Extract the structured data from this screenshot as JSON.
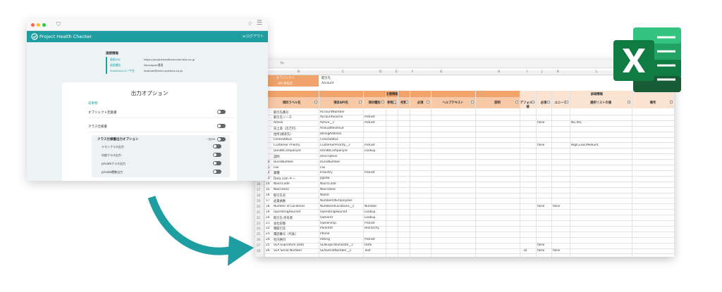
{
  "browser": {
    "app_title": "Project Health Checker",
    "logout_label": "ログアウト",
    "info": {
      "title": "接続情報",
      "rows": [
        {
          "k": "接続URL",
          "v": "https://projecthealthchecker.test.co.jp"
        },
        {
          "k": "接続種別",
          "v": "Developer環境"
        },
        {
          "k": "Salesforceユーザ名",
          "v": "testmail@ohm-systems.co.jp"
        }
      ]
    },
    "card": {
      "title": "出力オプション",
      "section": "成果物",
      "options": [
        "オブジェクト定義書",
        "クラス仕様書"
      ],
      "subsection": {
        "title": "クラス仕様書出力オプション",
        "all_label": "一括ON",
        "items": [
          "テストクラス出力",
          "内部クラス出力",
          "privateクラス出力",
          "private関数出力"
        ]
      }
    }
  },
  "excel": {
    "formula_bar": {
      "cell_ref": "A1",
      "fx": "fx"
    },
    "col_letters": [
      "B",
      "C",
      "D",
      "E",
      "F",
      "G",
      "H",
      "I",
      "J",
      "K",
      "L"
    ],
    "meta": [
      {
        "label": "オブジェクト",
        "value": "取引先"
      },
      {
        "label": "API 参照名",
        "value": "Account"
      }
    ],
    "group_headers": {
      "main": "主要情報",
      "detail": "詳細情報"
    },
    "headers": [
      "項目ラベル名",
      "項目API名",
      "項目種別",
      "参照先",
      "桁数",
      "必須",
      "ヘルプテキスト",
      "説明",
      "デフォルト値",
      "必須",
      "ユニーク",
      "選択リストの値",
      "備考"
    ],
    "rows": [
      {
        "n": "1",
        "label": "取引先番号",
        "api": "AccountNumber",
        "type": ""
      },
      {
        "n": "2",
        "label": "取引先ソース",
        "api": "AccountSource",
        "type": "Picklist"
      },
      {
        "n": "3",
        "label": "Active",
        "api": "Active__c",
        "type": "Picklist",
        "req": "false",
        "pick": "No,Yes;"
      },
      {
        "n": "4",
        "label": "売上高（百万円）",
        "api": "AnnualRevenue",
        "type": ""
      },
      {
        "n": "5",
        "label": "住所(請求先)",
        "api": "BillingAddress",
        "type": ""
      },
      {
        "n": "6",
        "label": "CleanStatus",
        "api": "CleanStatus",
        "type": ""
      },
      {
        "n": "7",
        "label": "Customer Priority",
        "api": "CustomerPriority__c",
        "type": "Picklist",
        "req": "false",
        "pick": "High,Low,Medium;"
      },
      {
        "n": "8",
        "label": "DandbCompanyId",
        "api": "DandbCompanyId",
        "type": "Lookup"
      },
      {
        "n": "9",
        "label": "説明",
        "api": "Description",
        "type": ""
      },
      {
        "n": "10",
        "label": "DunsNumber",
        "api": "DunsNumber",
        "type": ""
      },
      {
        "n": "11",
        "label": "Fax",
        "api": "Fax",
        "type": ""
      },
      {
        "n": "12",
        "label": "業種",
        "api": "Industry",
        "type": "Picklist"
      },
      {
        "n": "13",
        "label": "Data.com キー",
        "api": "Jigsaw",
        "type": ""
      },
      {
        "n": "14",
        "label": "NaicsCode",
        "api": "NaicsCode",
        "type": ""
      },
      {
        "n": "15",
        "label": "NaicsDesc",
        "api": "NaicsDesc",
        "type": ""
      },
      {
        "n": "16",
        "label": "取引先名",
        "api": "Name",
        "type": ""
      },
      {
        "n": "17",
        "label": "従業員数",
        "api": "NumberOfEmployees",
        "type": ""
      },
      {
        "n": "18",
        "label": "Number of Locations",
        "api": "NumberofLocations__c",
        "type": "Number",
        "req": "false",
        "uniq": "false"
      },
      {
        "n": "19",
        "label": "OperatingHoursId",
        "api": "OperatingHoursId",
        "type": "Lookup"
      },
      {
        "n": "20",
        "label": "取引先 所有者",
        "api": "OwnerId",
        "type": "Lookup"
      },
      {
        "n": "21",
        "label": "会社形態",
        "api": "Ownership",
        "type": "Picklist"
      },
      {
        "n": "22",
        "label": "親取引先",
        "api": "ParentId",
        "type": "Hierarchy"
      },
      {
        "n": "23",
        "label": "電話番号（代表）",
        "api": "Phone",
        "type": ""
      },
      {
        "n": "24",
        "label": "社内格付",
        "api": "Rating",
        "type": "Picklist"
      },
      {
        "n": "25",
        "label": "SLA Expiration Date",
        "api": "SLAExpirationDate__c",
        "type": "Date",
        "req": "false"
      },
      {
        "n": "26",
        "label": "SLA Serial Number",
        "api": "SLASerialNumber__c",
        "type": "Text",
        "digits": "10",
        "req": "false",
        "uniq": "false"
      }
    ]
  },
  "colors": {
    "teal": "#1e9ea0",
    "orange": "#f0a36a",
    "light_orange": "#fbe3d2",
    "excel_green": "#1d7a44"
  }
}
